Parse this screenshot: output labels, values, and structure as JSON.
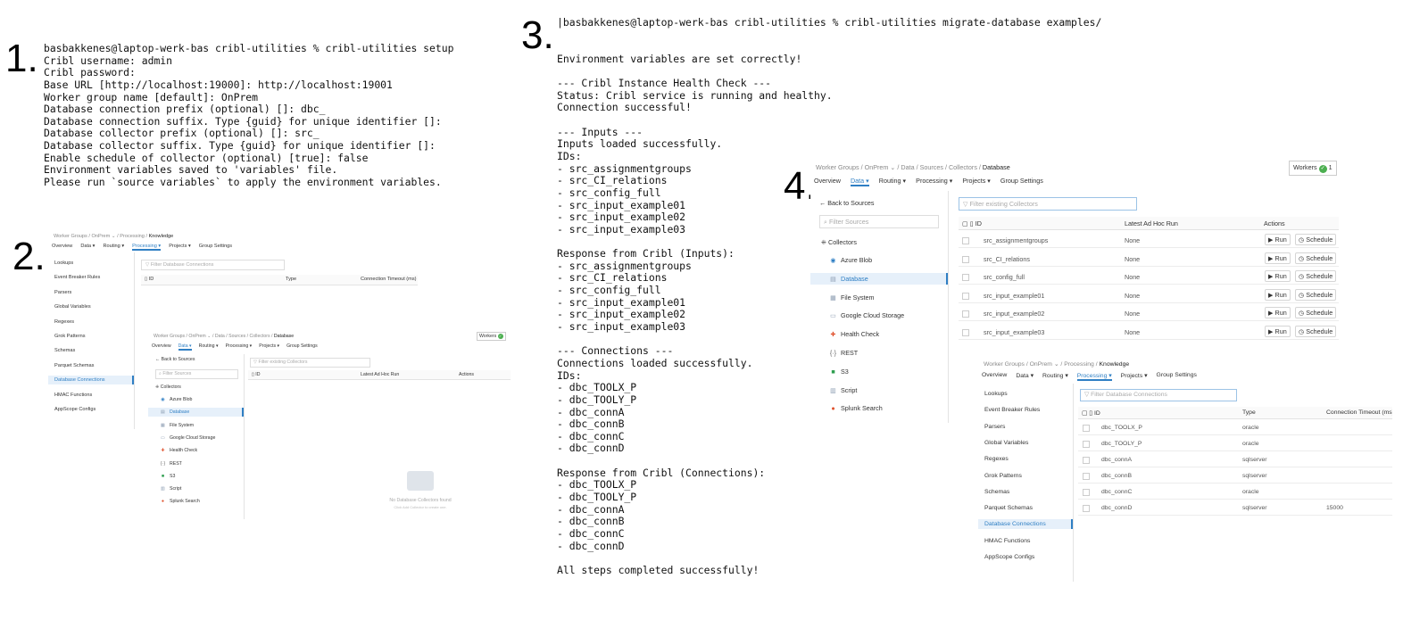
{
  "steps": {
    "s1": "1.",
    "s2": "2.",
    "s3": "3.",
    "s4": "4."
  },
  "terminal1": {
    "lines": [
      "basbakkenes@laptop-werk-bas cribl-utilities % cribl-utilities setup",
      "Cribl username: admin",
      "Cribl password:",
      "Base URL [http://localhost:19000]: http://localhost:19001",
      "Worker group name [default]: OnPrem",
      "Database connection prefix (optional) []: dbc_",
      "Database connection suffix. Type {guid} for unique identifier []:",
      "Database collector prefix (optional) []: src_",
      "Database collector suffix. Type {guid} for unique identifier []:",
      "Enable schedule of collector (optional) [true]: false",
      "Environment variables saved to 'variables' file.",
      "Please run `source variables` to apply the environment variables."
    ]
  },
  "terminal3": {
    "lines": [
      "|basbakkenes@laptop-werk-bas cribl-utilities % cribl-utilities migrate-database examples/",
      "",
      "",
      "Environment variables are set correctly!",
      "",
      "--- Cribl Instance Health Check ---",
      "Status: Cribl service is running and healthy.",
      "Connection successful!",
      "",
      "--- Inputs ---",
      "Inputs loaded successfully.",
      "IDs:",
      "- src_assignmentgroups",
      "- src_CI_relations",
      "- src_config_full",
      "- src_input_example01",
      "- src_input_example02",
      "- src_input_example03",
      "",
      "Response from Cribl (Inputs):",
      "- src_assignmentgroups",
      "- src_CI_relations",
      "- src_config_full",
      "- src_input_example01",
      "- src_input_example02",
      "- src_input_example03",
      "",
      "--- Connections ---",
      "Connections loaded successfully.",
      "IDs:",
      "- dbc_TOOLX_P",
      "- dbc_TOOLY_P",
      "- dbc_connA",
      "- dbc_connB",
      "- dbc_connC",
      "- dbc_connD",
      "",
      "Response from Cribl (Connections):",
      "- dbc_TOOLX_P",
      "- dbc_TOOLY_P",
      "- dbc_connA",
      "- dbc_connB",
      "- dbc_connC",
      "- dbc_connD",
      "",
      "All steps completed successfully!"
    ]
  },
  "knowledge_ui": {
    "crumb_root": "Worker Groups",
    "crumb_group": "OnPrem",
    "crumb_section": "Processing",
    "crumb_page": "Knowledge",
    "nav": [
      "Overview",
      "Data ▾",
      "Routing ▾",
      "Processing ▾",
      "Projects ▾",
      "Group Settings"
    ],
    "active_nav": 3,
    "sidebar": [
      "Lookups",
      "Event Breaker Rules",
      "Parsers",
      "Global Variables",
      "Regexes",
      "Grok Patterns",
      "Schemas",
      "Parquet Schemas",
      "Database Connections",
      "HMAC Functions",
      "AppScope Configs"
    ],
    "active_sidebar": 8,
    "filter_placeholder": "Filter Database Connections",
    "columns": [
      "ID",
      "Type",
      "Connection Timeout (ms)"
    ],
    "rows": [
      {
        "id": "dbc_TOOLX_P",
        "type": "oracle",
        "timeout": ""
      },
      {
        "id": "dbc_TOOLY_P",
        "type": "oracle",
        "timeout": ""
      },
      {
        "id": "dbc_connA",
        "type": "sqlserver",
        "timeout": ""
      },
      {
        "id": "dbc_connB",
        "type": "sqlserver",
        "timeout": ""
      },
      {
        "id": "dbc_connC",
        "type": "oracle",
        "timeout": ""
      },
      {
        "id": "dbc_connD",
        "type": "sqlserver",
        "timeout": "15000"
      }
    ]
  },
  "sources_ui": {
    "crumb_root": "Worker Groups",
    "crumb_group": "OnPrem",
    "crumb_data": "Data",
    "crumb_sources": "Sources",
    "crumb_collectors": "Collectors",
    "crumb_page": "Database",
    "workers_label": "Workers",
    "workers_count": "1",
    "nav": [
      "Overview",
      "Data ▾",
      "Routing ▾",
      "Processing ▾",
      "Projects ▾",
      "Group Settings"
    ],
    "active_nav": 1,
    "back_label": "Back to Sources",
    "filter_sources": "Filter Sources",
    "collectors_label": "Collectors",
    "sources": [
      "Azure Blob",
      "Database",
      "File System",
      "Google Cloud Storage",
      "Health Check",
      "REST",
      "S3",
      "Script",
      "Splunk Search"
    ],
    "source_icons": [
      "azure-blob-icon",
      "database-icon",
      "file-system-icon",
      "google-cloud-storage-icon",
      "health-check-icon",
      "rest-icon",
      "s3-icon",
      "script-icon",
      "splunk-search-icon"
    ],
    "active_source": 1,
    "filter_collectors": "Filter existing Collectors",
    "columns": [
      "ID",
      "Latest Ad Hoc Run",
      "Actions"
    ],
    "rows": [
      {
        "id": "src_assignmentgroups",
        "run": "None"
      },
      {
        "id": "src_CI_relations",
        "run": "None"
      },
      {
        "id": "src_config_full",
        "run": "None"
      },
      {
        "id": "src_input_example01",
        "run": "None"
      },
      {
        "id": "src_input_example02",
        "run": "None"
      },
      {
        "id": "src_input_example03",
        "run": "None"
      }
    ],
    "run_label": "Run",
    "schedule_label": "Schedule",
    "empty_title": "No Database Collectors found",
    "empty_hint": "Click Add Collector to create one."
  },
  "colors": {
    "accent": "#2f7fc4",
    "active_bg": "#e6f0fa",
    "ok_green": "#4caf50"
  }
}
